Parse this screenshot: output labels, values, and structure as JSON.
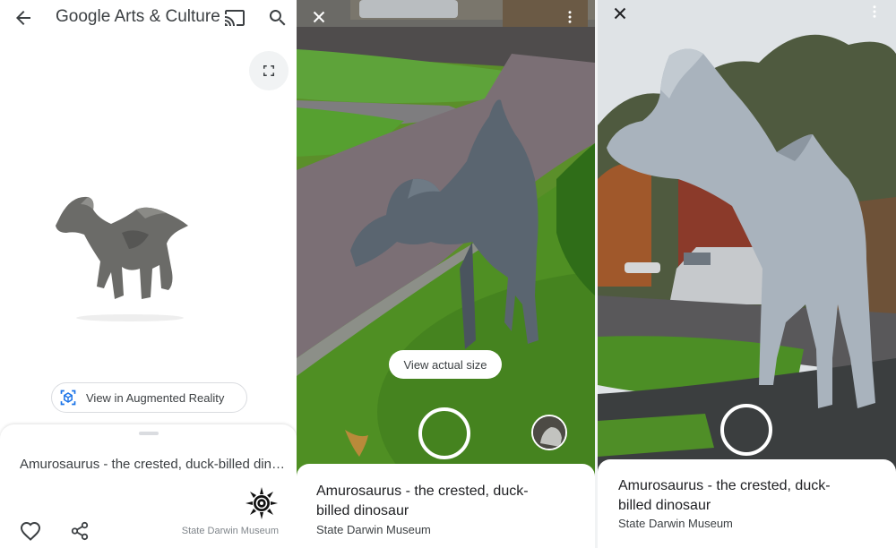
{
  "app": {
    "brand_google": "Google",
    "brand_rest": " Arts & Culture"
  },
  "viewer": {
    "ar_button_label": "View in Augmented Reality",
    "title": "Amurosaurus - the crested, duck-billed dinosaur",
    "museum": "State Darwin Museum"
  },
  "ar_session_1": {
    "actual_size_label": "View actual size",
    "title": "Amurosaurus - the crested, duck-billed dinosaur",
    "museum": "State Darwin Museum"
  },
  "ar_session_2": {
    "title": "Amurosaurus - the crested, duck-billed dinosaur",
    "museum": "State Darwin Museum"
  },
  "icons": {
    "back": "arrow-left",
    "cast": "cast",
    "search": "magnifier",
    "fullscreen": "fullscreen-corners",
    "ar": "ar-cube",
    "like": "heart-outline",
    "share": "share-nodes",
    "close": "x-mark",
    "overflow": "three-dots-vertical"
  },
  "colors": {
    "accent_blue": "#1a73e8",
    "text_primary": "#202124",
    "text_secondary": "#80868b",
    "surface": "#ffffff",
    "chip_gray": "#f1f3f4"
  }
}
